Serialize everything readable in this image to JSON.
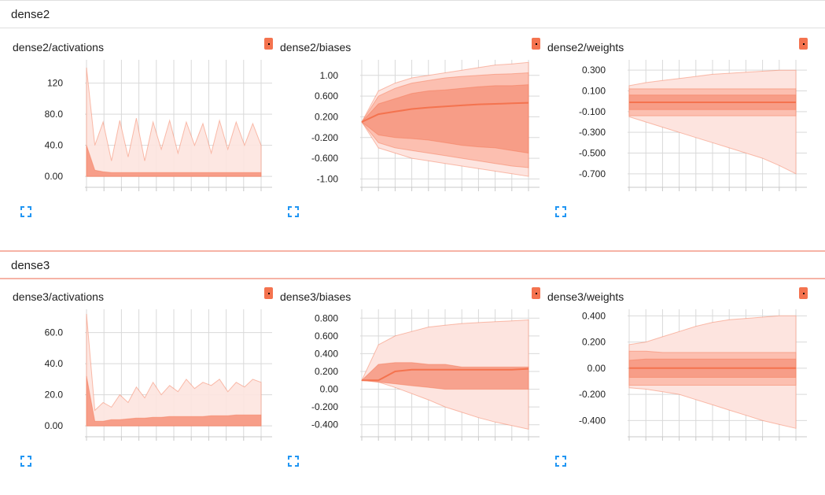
{
  "palette": {
    "accent": "#f4734f",
    "band_light": "#fde4df",
    "band_mid": "#fbb8a8",
    "band_dark": "#f69680",
    "line": "#f4734f",
    "grid": "#d9d9d9",
    "expand_icon": "#2196f3"
  },
  "sections": [
    {
      "title": "dense2",
      "cards": [
        {
          "title": "dense2/activations",
          "chart_data": {
            "type": "area",
            "y_ticks": [
              "120",
              "80.0",
              "40.0",
              "0.00"
            ],
            "y_values": [
              120,
              80,
              40,
              0
            ],
            "ylim": [
              -10,
              150
            ],
            "series": [
              {
                "role": "spikes-outer",
                "upper": [
                  140,
                  40,
                  70,
                  20,
                  72,
                  25,
                  75,
                  20,
                  70,
                  35,
                  72,
                  30,
                  70,
                  40,
                  68,
                  30,
                  72,
                  35,
                  70,
                  40,
                  68,
                  40
                ],
                "lower": [
                  0,
                  0,
                  0,
                  0,
                  0,
                  0,
                  0,
                  0,
                  0,
                  0,
                  0,
                  0,
                  0,
                  0,
                  0,
                  0,
                  0,
                  0,
                  0,
                  0,
                  0,
                  0
                ]
              },
              {
                "role": "band-inner",
                "upper": [
                  40,
                  8,
                  6,
                  5,
                  5,
                  5,
                  5,
                  5,
                  5,
                  5,
                  5,
                  5,
                  5,
                  5,
                  5,
                  5,
                  5,
                  5,
                  5,
                  5,
                  5,
                  5
                ],
                "lower": [
                  0,
                  0,
                  0,
                  0,
                  0,
                  0,
                  0,
                  0,
                  0,
                  0,
                  0,
                  0,
                  0,
                  0,
                  0,
                  0,
                  0,
                  0,
                  0,
                  0,
                  0,
                  0
                ]
              }
            ]
          }
        },
        {
          "title": "dense2/biases",
          "chart_data": {
            "type": "area",
            "y_ticks": [
              "1.00",
              "0.600",
              "0.200",
              "-0.200",
              "-0.600",
              "-1.00"
            ],
            "y_values": [
              1.0,
              0.6,
              0.2,
              -0.2,
              -0.6,
              -1.0
            ],
            "ylim": [
              -1.1,
              1.3
            ],
            "series": [
              {
                "role": "outer",
                "upper": [
                  0.1,
                  0.7,
                  0.85,
                  0.95,
                  1.0,
                  1.05,
                  1.1,
                  1.15,
                  1.2,
                  1.22,
                  1.25
                ],
                "lower": [
                  0.1,
                  -0.4,
                  -0.5,
                  -0.6,
                  -0.65,
                  -0.7,
                  -0.75,
                  -0.8,
                  -0.85,
                  -0.9,
                  -0.95
                ]
              },
              {
                "role": "mid",
                "upper": [
                  0.1,
                  0.6,
                  0.75,
                  0.85,
                  0.9,
                  0.95,
                  0.98,
                  1.0,
                  1.02,
                  1.03,
                  1.05
                ],
                "lower": [
                  0.1,
                  -0.3,
                  -0.4,
                  -0.45,
                  -0.5,
                  -0.55,
                  -0.6,
                  -0.65,
                  -0.7,
                  -0.75,
                  -0.78
                ]
              },
              {
                "role": "inner",
                "upper": [
                  0.1,
                  0.45,
                  0.55,
                  0.65,
                  0.7,
                  0.72,
                  0.75,
                  0.78,
                  0.8,
                  0.8,
                  0.82
                ],
                "lower": [
                  0.1,
                  -0.15,
                  -0.2,
                  -0.22,
                  -0.25,
                  -0.3,
                  -0.35,
                  -0.38,
                  -0.4,
                  -0.45,
                  -0.5
                ]
              },
              {
                "role": "median",
                "line": [
                  0.1,
                  0.25,
                  0.3,
                  0.35,
                  0.38,
                  0.4,
                  0.42,
                  0.44,
                  0.45,
                  0.46,
                  0.47
                ]
              }
            ]
          }
        },
        {
          "title": "dense2/weights",
          "chart_data": {
            "type": "area",
            "y_ticks": [
              "0.300",
              "0.100",
              "-0.100",
              "-0.300",
              "-0.500",
              "-0.700"
            ],
            "y_values": [
              0.3,
              0.1,
              -0.1,
              -0.3,
              -0.5,
              -0.7
            ],
            "ylim": [
              -0.8,
              0.4
            ],
            "series": [
              {
                "role": "outer",
                "upper": [
                  0.15,
                  0.18,
                  0.2,
                  0.22,
                  0.24,
                  0.26,
                  0.27,
                  0.28,
                  0.29,
                  0.3,
                  0.3
                ],
                "lower": [
                  -0.15,
                  -0.2,
                  -0.25,
                  -0.3,
                  -0.35,
                  -0.4,
                  -0.45,
                  -0.5,
                  -0.55,
                  -0.62,
                  -0.7
                ]
              },
              {
                "role": "mid",
                "upper": [
                  0.12,
                  0.12,
                  0.12,
                  0.12,
                  0.12,
                  0.12,
                  0.12,
                  0.12,
                  0.12,
                  0.12,
                  0.12
                ],
                "lower": [
                  -0.14,
                  -0.14,
                  -0.14,
                  -0.14,
                  -0.14,
                  -0.14,
                  -0.14,
                  -0.14,
                  -0.14,
                  -0.14,
                  -0.14
                ]
              },
              {
                "role": "inner",
                "upper": [
                  0.06,
                  0.06,
                  0.06,
                  0.06,
                  0.06,
                  0.06,
                  0.06,
                  0.06,
                  0.06,
                  0.06,
                  0.06
                ],
                "lower": [
                  -0.08,
                  -0.08,
                  -0.08,
                  -0.08,
                  -0.08,
                  -0.08,
                  -0.08,
                  -0.08,
                  -0.08,
                  -0.08,
                  -0.08
                ]
              },
              {
                "role": "median",
                "line": [
                  -0.01,
                  -0.01,
                  -0.01,
                  -0.01,
                  -0.01,
                  -0.01,
                  -0.01,
                  -0.01,
                  -0.01,
                  -0.01,
                  -0.01
                ]
              }
            ]
          }
        }
      ]
    },
    {
      "title": "dense3",
      "cards": [
        {
          "title": "dense3/activations",
          "chart_data": {
            "type": "area",
            "y_ticks": [
              "60.0",
              "40.0",
              "20.0",
              "0.00"
            ],
            "y_values": [
              60,
              40,
              20,
              0
            ],
            "ylim": [
              -5,
              75
            ],
            "series": [
              {
                "role": "spikes-outer",
                "upper": [
                  72,
                  10,
                  15,
                  12,
                  20,
                  15,
                  25,
                  18,
                  28,
                  20,
                  26,
                  22,
                  30,
                  24,
                  28,
                  26,
                  30,
                  22,
                  28,
                  25,
                  30,
                  28
                ],
                "lower": [
                  0,
                  0,
                  0,
                  0,
                  0,
                  0,
                  0,
                  0,
                  0,
                  0,
                  0,
                  0,
                  0,
                  0,
                  0,
                  0,
                  0,
                  0,
                  0,
                  0,
                  0,
                  0
                ]
              },
              {
                "role": "band-inner",
                "upper": [
                  32,
                  3,
                  3,
                  4,
                  4,
                  4.5,
                  5,
                  5,
                  5.5,
                  5.5,
                  6,
                  6,
                  6,
                  6,
                  6,
                  6.5,
                  6.5,
                  6.5,
                  7,
                  7,
                  7,
                  7
                ],
                "lower": [
                  0,
                  0,
                  0,
                  0,
                  0,
                  0,
                  0,
                  0,
                  0,
                  0,
                  0,
                  0,
                  0,
                  0,
                  0,
                  0,
                  0,
                  0,
                  0,
                  0,
                  0,
                  0
                ]
              }
            ]
          }
        },
        {
          "title": "dense3/biases",
          "chart_data": {
            "type": "area",
            "y_ticks": [
              "0.800",
              "0.600",
              "0.400",
              "0.200",
              "0.00",
              "-0.200",
              "-0.400"
            ],
            "y_values": [
              0.8,
              0.6,
              0.4,
              0.2,
              0.0,
              -0.2,
              -0.4
            ],
            "ylim": [
              -0.5,
              0.9
            ],
            "series": [
              {
                "role": "outer",
                "upper": [
                  0.1,
                  0.5,
                  0.6,
                  0.65,
                  0.7,
                  0.72,
                  0.74,
                  0.75,
                  0.76,
                  0.77,
                  0.78
                ],
                "lower": [
                  0.1,
                  0.08,
                  0.02,
                  -0.05,
                  -0.12,
                  -0.2,
                  -0.26,
                  -0.32,
                  -0.37,
                  -0.41,
                  -0.45
                ]
              },
              {
                "role": "inner",
                "upper": [
                  0.1,
                  0.28,
                  0.3,
                  0.3,
                  0.28,
                  0.28,
                  0.25,
                  0.25,
                  0.25,
                  0.25,
                  0.25
                ],
                "lower": [
                  0.1,
                  0.08,
                  0.06,
                  0.04,
                  0.02,
                  0.0,
                  0.0,
                  0.0,
                  0.0,
                  0.0,
                  0.0
                ]
              },
              {
                "role": "median",
                "line": [
                  0.1,
                  0.1,
                  0.2,
                  0.22,
                  0.22,
                  0.22,
                  0.22,
                  0.22,
                  0.22,
                  0.22,
                  0.23
                ]
              }
            ]
          }
        },
        {
          "title": "dense3/weights",
          "chart_data": {
            "type": "area",
            "y_ticks": [
              "0.400",
              "0.200",
              "0.00",
              "-0.200",
              "-0.400"
            ],
            "y_values": [
              0.4,
              0.2,
              0.0,
              -0.2,
              -0.4
            ],
            "ylim": [
              -0.5,
              0.45
            ],
            "series": [
              {
                "role": "outer",
                "upper": [
                  0.18,
                  0.2,
                  0.24,
                  0.28,
                  0.32,
                  0.35,
                  0.37,
                  0.38,
                  0.39,
                  0.4,
                  0.4
                ],
                "lower": [
                  -0.15,
                  -0.16,
                  -0.18,
                  -0.2,
                  -0.24,
                  -0.28,
                  -0.32,
                  -0.36,
                  -0.4,
                  -0.43,
                  -0.46
                ]
              },
              {
                "role": "mid",
                "upper": [
                  0.13,
                  0.13,
                  0.12,
                  0.12,
                  0.12,
                  0.12,
                  0.12,
                  0.12,
                  0.12,
                  0.12,
                  0.12
                ],
                "lower": [
                  -0.13,
                  -0.13,
                  -0.13,
                  -0.13,
                  -0.13,
                  -0.13,
                  -0.13,
                  -0.13,
                  -0.13,
                  -0.13,
                  -0.13
                ]
              },
              {
                "role": "inner",
                "upper": [
                  0.06,
                  0.07,
                  0.07,
                  0.07,
                  0.07,
                  0.07,
                  0.07,
                  0.07,
                  0.07,
                  0.07,
                  0.07
                ],
                "lower": [
                  -0.07,
                  -0.07,
                  -0.07,
                  -0.07,
                  -0.07,
                  -0.07,
                  -0.07,
                  -0.07,
                  -0.07,
                  -0.07,
                  -0.07
                ]
              },
              {
                "role": "median",
                "line": [
                  0.0,
                  0.0,
                  0.0,
                  0.0,
                  0.0,
                  0.0,
                  0.0,
                  0.0,
                  0.0,
                  0.0,
                  0.0
                ]
              }
            ]
          }
        }
      ]
    }
  ]
}
